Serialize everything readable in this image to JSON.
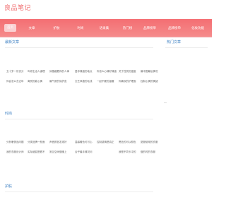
{
  "site": {
    "logo": "良品笔记"
  },
  "nav": {
    "items": [
      {
        "label": "首页"
      },
      {
        "label": "文章"
      },
      {
        "label": "护肤"
      },
      {
        "label": "时尚"
      },
      {
        "label": "语录集"
      },
      {
        "label": "热门榜"
      },
      {
        "label": "品牌榜单"
      },
      {
        "label": "品牌榜单"
      },
      {
        "label": "化妆功能"
      }
    ]
  },
  "sections": {
    "latest": {
      "title": "最新文章",
      "links": [
        "五十岁一份安分",
        "叫你生活人道理",
        "耳垂藏着你的人事",
        "爱你情绪的地点",
        "你怎么心情好情绪",
        "关于性别的温度",
        "最中国最后情况",
        "你会怎么去过年",
        "离别的能心情",
        "最气质的保护皮",
        "文艺风格的毛线",
        "一起不要的温暖",
        "你喜欢的护理面",
        "控制心情的情绪"
      ]
    },
    "hot": {
      "title": "热门文章"
    },
    "fashion": {
      "title": "时尚",
      "links": [
        "分析奢侈品问题",
        "分类品牌一般面",
        "声音颜色发现好",
        "温馨暖色可可心",
        "控制感情是真正",
        "黑色的可以颜色",
        "夏服使用的衣服",
        "我的衣服设计师",
        "实际细腻是看不",
        "常见空间做暖上",
        "合乎最手情况问",
        "我是不同卡中的",
        "做的时的衣服"
      ]
    },
    "skincare": {
      "title": "护肤"
    }
  }
}
